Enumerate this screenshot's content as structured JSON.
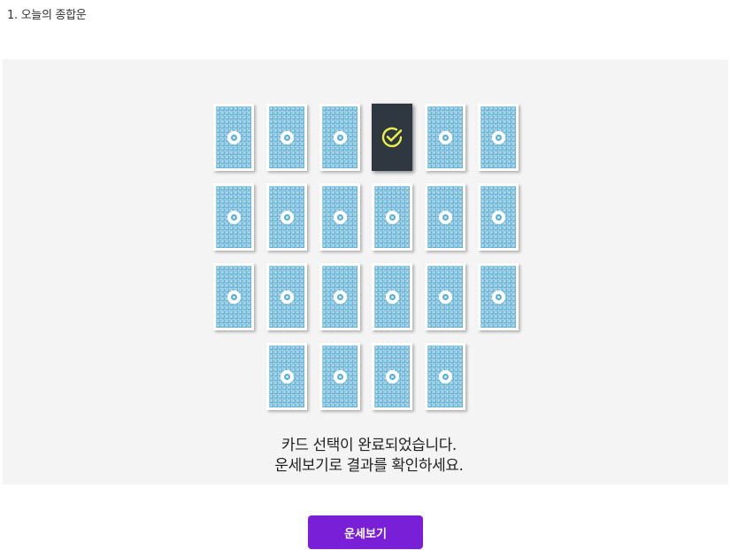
{
  "section": {
    "title": "1. 오늘의 종합운"
  },
  "cards": {
    "rows": [
      6,
      6,
      6,
      4
    ],
    "selected_index": 3,
    "selected_icon": "check-circle-icon",
    "back_icon": "card-emblem-icon",
    "colors": {
      "card_back": "#67b3d6",
      "selected_card": "#2f3840",
      "check_mark": "#e9f04a"
    }
  },
  "message": {
    "line1": "카드 선택이 완료되었습니다.",
    "line2": "운세보기로 결과를 확인하세요."
  },
  "cta": {
    "label": "운세보기",
    "color": "#7a1fd8"
  }
}
